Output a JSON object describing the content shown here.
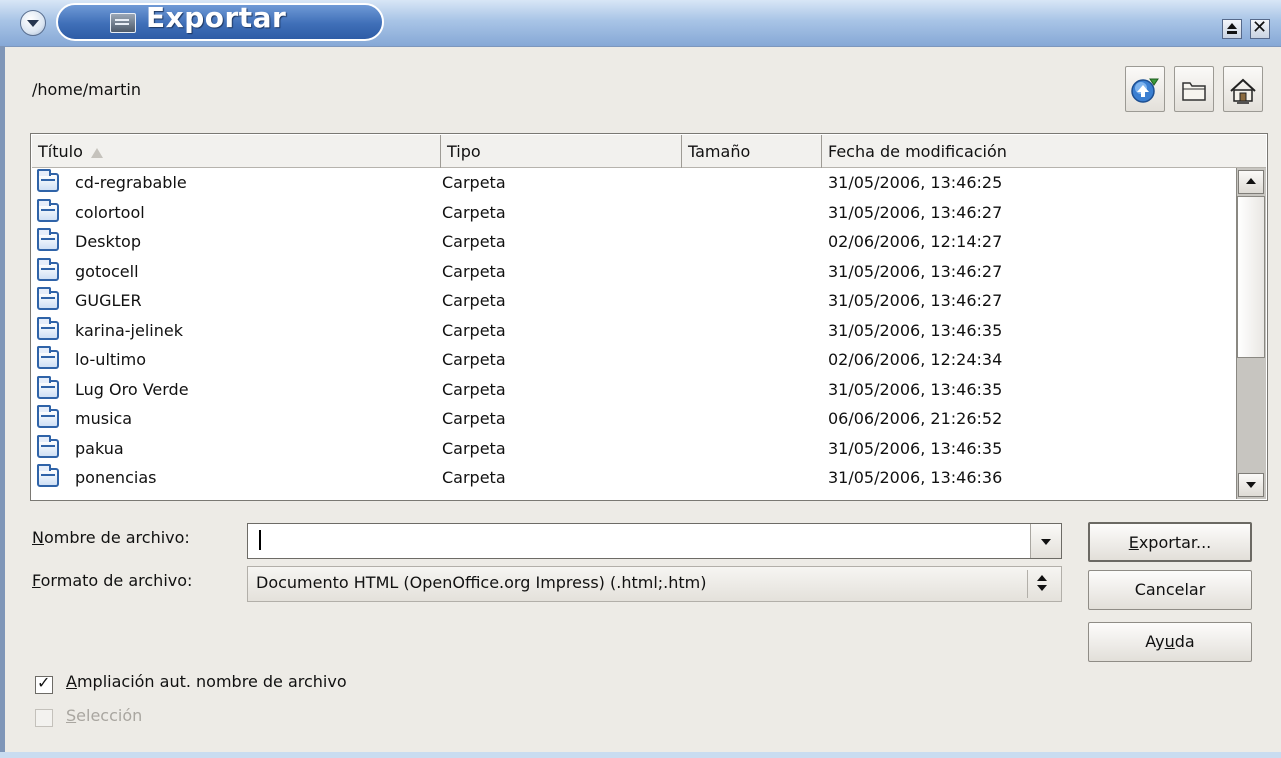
{
  "window": {
    "title": "Exportar"
  },
  "path": "/home/martin",
  "columns": [
    "Título",
    "Tipo",
    "Tamaño",
    "Fecha de modificación"
  ],
  "files": [
    {
      "name": "cd-regrabable",
      "type": "Carpeta",
      "size": "",
      "date": "31/05/2006, 13:46:25"
    },
    {
      "name": "colortool",
      "type": "Carpeta",
      "size": "",
      "date": "31/05/2006, 13:46:27"
    },
    {
      "name": "Desktop",
      "type": "Carpeta",
      "size": "",
      "date": "02/06/2006, 12:14:27"
    },
    {
      "name": "gotocell",
      "type": "Carpeta",
      "size": "",
      "date": "31/05/2006, 13:46:27"
    },
    {
      "name": "GUGLER",
      "type": "Carpeta",
      "size": "",
      "date": "31/05/2006, 13:46:27"
    },
    {
      "name": "karina-jelinek",
      "type": "Carpeta",
      "size": "",
      "date": "31/05/2006, 13:46:35"
    },
    {
      "name": "lo-ultimo",
      "type": "Carpeta",
      "size": "",
      "date": "02/06/2006, 12:24:34"
    },
    {
      "name": "Lug Oro Verde",
      "type": "Carpeta",
      "size": "",
      "date": "31/05/2006, 13:46:35"
    },
    {
      "name": "musica",
      "type": "Carpeta",
      "size": "",
      "date": "06/06/2006, 21:26:52"
    },
    {
      "name": "pakua",
      "type": "Carpeta",
      "size": "",
      "date": "31/05/2006, 13:46:35"
    },
    {
      "name": "ponencias",
      "type": "Carpeta",
      "size": "",
      "date": "31/05/2006, 13:46:36"
    }
  ],
  "form": {
    "filename_label_prefix": "",
    "filename_label_mnemonic": "N",
    "filename_label_rest": "ombre de archivo:",
    "filename_value": "",
    "format_label_mnemonic": "F",
    "format_label_rest": "ormato de archivo:",
    "format_value": "Documento HTML (OpenOffice.org Impress) (.html;.htm)"
  },
  "buttons": {
    "export_mnemonic": "E",
    "export_rest": "xportar...",
    "cancel": "Cancelar",
    "help_pre": "Ay",
    "help_mnemonic": "u",
    "help_post": "da"
  },
  "options": {
    "auto_extension_mnemonic": "A",
    "auto_extension_rest": "mpliación aut. nombre de archivo",
    "auto_extension_checked": true,
    "selection_mnemonic": "S",
    "selection_rest": "elección",
    "selection_enabled": false
  },
  "icons": {
    "menu": "chevron-down-icon",
    "app": "document-icon",
    "up": "up-folder-icon",
    "new_folder": "new-folder-icon",
    "home": "home-icon",
    "folder": "folder-icon",
    "sort": "sort-ascending-icon"
  },
  "colors": {
    "titlebar": "#86a8d6",
    "title_pill": "#3f6fb8",
    "folder_icon": "#2f63a8",
    "dialog_bg": "#edebe6"
  }
}
